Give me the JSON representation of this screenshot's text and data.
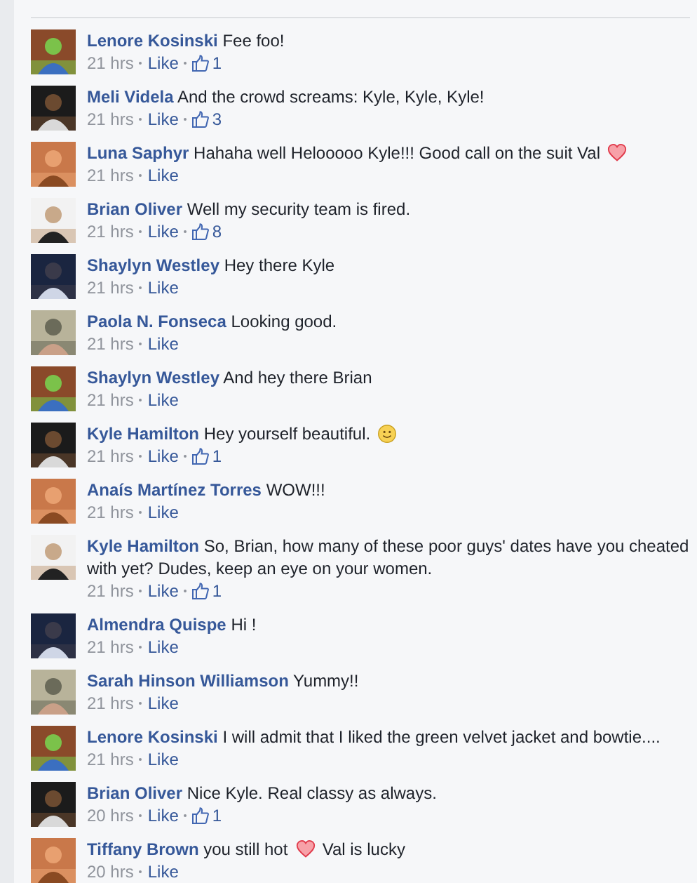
{
  "comments": [
    {
      "author": "Lenore Kosinski",
      "parts": [
        {
          "kind": "text",
          "text": "Fee foo!"
        }
      ],
      "time": "21 hrs",
      "action": "Like",
      "likes": "1"
    },
    {
      "author": "Meli Videla",
      "parts": [
        {
          "kind": "text",
          "text": "And the crowd screams: Kyle, Kyle, Kyle!"
        }
      ],
      "time": "21 hrs",
      "action": "Like",
      "likes": "3"
    },
    {
      "author": "Luna Saphyr",
      "parts": [
        {
          "kind": "text",
          "text": "Hahaha well Helooooo Kyle!!! Good call on the suit Val"
        },
        {
          "kind": "heart"
        }
      ],
      "time": "21 hrs",
      "action": "Like"
    },
    {
      "author": "Brian Oliver",
      "parts": [
        {
          "kind": "text",
          "text": "Well my security team is fired."
        }
      ],
      "time": "21 hrs",
      "action": "Like",
      "likes": "8"
    },
    {
      "author": "Shaylyn Westley",
      "parts": [
        {
          "kind": "text",
          "text": "Hey there Kyle"
        }
      ],
      "time": "21 hrs",
      "action": "Like"
    },
    {
      "author": "Paola N. Fonseca",
      "parts": [
        {
          "kind": "text",
          "text": "Looking good."
        }
      ],
      "time": "21 hrs",
      "action": "Like"
    },
    {
      "author": "Shaylyn Westley",
      "parts": [
        {
          "kind": "text",
          "text": "And hey there Brian"
        }
      ],
      "time": "21 hrs",
      "action": "Like"
    },
    {
      "author": "Kyle Hamilton",
      "parts": [
        {
          "kind": "text",
          "text": "Hey yourself beautiful."
        },
        {
          "kind": "smiley"
        }
      ],
      "time": "21 hrs",
      "action": "Like",
      "likes": "1"
    },
    {
      "author": "Anaís Martínez Torres",
      "parts": [
        {
          "kind": "text",
          "text": "WOW!!!"
        }
      ],
      "time": "21 hrs",
      "action": "Like"
    },
    {
      "author": "Kyle Hamilton",
      "parts": [
        {
          "kind": "text",
          "text": "So, Brian, how many of these poor guys' dates have you cheated with yet? Dudes, keep an eye on your women."
        }
      ],
      "time": "21 hrs",
      "action": "Like",
      "likes": "1"
    },
    {
      "author": "Almendra Quispe",
      "parts": [
        {
          "kind": "text",
          "text": "Hi !"
        }
      ],
      "time": "21 hrs",
      "action": "Like"
    },
    {
      "author": "Sarah Hinson Williamson",
      "parts": [
        {
          "kind": "text",
          "text": "Yummy!!"
        }
      ],
      "time": "21 hrs",
      "action": "Like"
    },
    {
      "author": "Lenore Kosinski",
      "parts": [
        {
          "kind": "text",
          "text": "I will admit that I liked the green velvet jacket and bowtie...."
        }
      ],
      "time": "21 hrs",
      "action": "Like"
    },
    {
      "author": "Brian Oliver",
      "parts": [
        {
          "kind": "text",
          "text": "Nice Kyle. Real classy as always."
        }
      ],
      "time": "20 hrs",
      "action": "Like",
      "likes": "1"
    },
    {
      "author": "Tiffany Brown",
      "parts": [
        {
          "kind": "text",
          "text": "you still hot"
        },
        {
          "kind": "heart"
        },
        {
          "kind": "text",
          "text": "Val is lucky"
        }
      ],
      "time": "20 hrs",
      "action": "Like"
    }
  ]
}
